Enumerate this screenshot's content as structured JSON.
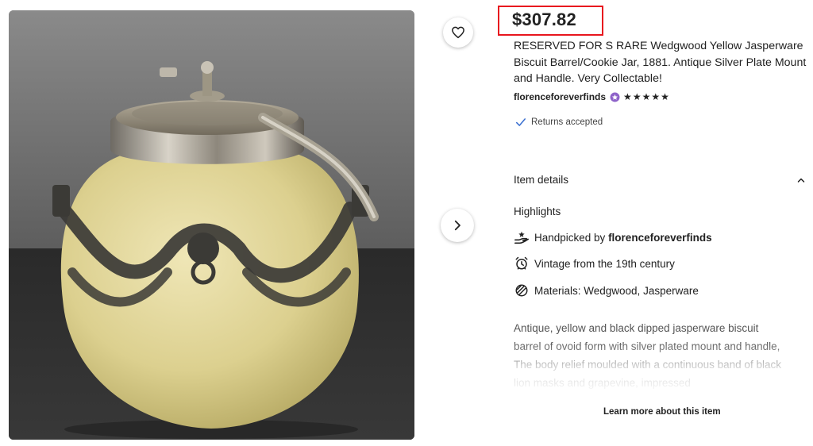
{
  "listing": {
    "price": "$307.82",
    "title": "RESERVED FOR S RARE Wedgwood Yellow Jasperware Biscuit Barrel/Cookie Jar, 1881. Antique Silver Plate Mount and Handle. Very Collectable!",
    "shop_name": "florenceforeverfinds",
    "rating_stars": 5,
    "returns_text": "Returns accepted"
  },
  "photo": {
    "favorite_icon": "heart-icon",
    "next_icon": "chevron-right-icon"
  },
  "item_details": {
    "header": "Item details",
    "highlights_label": "Highlights",
    "highlights": [
      {
        "icon": "hand-icon",
        "prefix": "Handpicked by ",
        "bold": "florenceforeverfinds"
      },
      {
        "icon": "alarm-clock-icon",
        "text": "Vintage from the 19th century"
      },
      {
        "icon": "materials-icon",
        "text": "Materials: Wedgwood, Jasperware"
      }
    ],
    "description": "Antique, yellow and black dipped jasperware biscuit barrel of ovoid form with silver plated mount and handle, The body relief moulded with a continuous band of black lion masks and grapevine, impressed",
    "learn_more": "Learn more about this item"
  },
  "colors": {
    "price_highlight": "#e8161e",
    "star_seller_badge": "#8e63c9",
    "check": "#3a6fd0"
  }
}
